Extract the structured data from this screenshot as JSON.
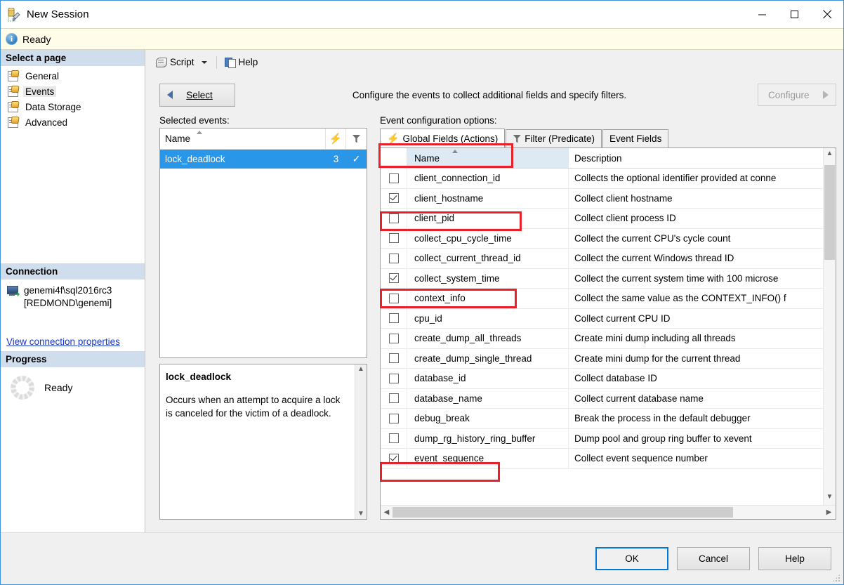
{
  "window": {
    "title": "New Session",
    "icon": "new-session-icon",
    "controls": {
      "minimize": "─",
      "maximize": "☐",
      "close": "✕"
    }
  },
  "status": {
    "icon": "info-icon",
    "text": "Ready"
  },
  "sidebar": {
    "header": "Select a page",
    "items": [
      {
        "label": "General",
        "selected": false
      },
      {
        "label": "Events",
        "selected": true
      },
      {
        "label": "Data Storage",
        "selected": false
      },
      {
        "label": "Advanced",
        "selected": false
      }
    ],
    "connection": {
      "header": "Connection",
      "server": "genemi4f\\sql2016rc3",
      "user": "[REDMOND\\genemi]",
      "link": "View connection properties"
    },
    "progress": {
      "header": "Progress",
      "text": "Ready"
    }
  },
  "toolbar": {
    "script_label": "Script",
    "help_label": "Help"
  },
  "instruction": {
    "select_button": "Select",
    "text": "Configure the events to collect additional fields and specify filters.",
    "configure_button": "Configure"
  },
  "selected_events": {
    "label": "Selected events:",
    "columns": [
      "Name",
      "actions-column",
      "filter-column"
    ],
    "rows": [
      {
        "name": "lock_deadlock",
        "actions": "3",
        "filter": "✓",
        "selected": true
      }
    ]
  },
  "description": {
    "title": "lock_deadlock",
    "text": "Occurs when an attempt to acquire a lock is canceled for the victim of a deadlock."
  },
  "event_config": {
    "label": "Event configuration options:",
    "tabs": [
      {
        "label": "Global Fields (Actions)",
        "icon": "lightning-icon",
        "active": true,
        "highlighted": true
      },
      {
        "label": "Filter (Predicate)",
        "icon": "funnel-icon",
        "active": false,
        "highlighted": false
      },
      {
        "label": "Event Fields",
        "icon": "",
        "active": false,
        "highlighted": false
      }
    ],
    "columns": {
      "name": "Name",
      "description": "Description"
    },
    "rows": [
      {
        "checked": false,
        "name": "client_connection_id",
        "description": "Collects the optional identifier provided at conne",
        "highlighted": false
      },
      {
        "checked": true,
        "name": "client_hostname",
        "description": "Collect client hostname",
        "highlighted": true
      },
      {
        "checked": false,
        "name": "client_pid",
        "description": "Collect client process ID",
        "highlighted": false
      },
      {
        "checked": false,
        "name": "collect_cpu_cycle_time",
        "description": "Collect the current CPU's cycle count",
        "highlighted": false
      },
      {
        "checked": false,
        "name": "collect_current_thread_id",
        "description": "Collect the current Windows thread ID",
        "highlighted": false
      },
      {
        "checked": true,
        "name": "collect_system_time",
        "description": "Collect the current system time with 100 microse",
        "highlighted": true
      },
      {
        "checked": false,
        "name": "context_info",
        "description": "Collect the same value as the CONTEXT_INFO() f",
        "highlighted": false
      },
      {
        "checked": false,
        "name": "cpu_id",
        "description": "Collect current CPU ID",
        "highlighted": false
      },
      {
        "checked": false,
        "name": "create_dump_all_threads",
        "description": "Create mini dump including all threads",
        "highlighted": false
      },
      {
        "checked": false,
        "name": "create_dump_single_thread",
        "description": "Create mini dump for the current thread",
        "highlighted": false
      },
      {
        "checked": false,
        "name": "database_id",
        "description": "Collect database ID",
        "highlighted": false
      },
      {
        "checked": false,
        "name": "database_name",
        "description": "Collect current database name",
        "highlighted": false
      },
      {
        "checked": false,
        "name": "debug_break",
        "description": "Break the process in the default debugger",
        "highlighted": false
      },
      {
        "checked": false,
        "name": "dump_rg_history_ring_buffer",
        "description": "Dump pool and group ring buffer to xevent",
        "highlighted": false
      },
      {
        "checked": true,
        "name": "event_sequence",
        "description": "Collect event sequence number",
        "highlighted": true
      }
    ]
  },
  "footer": {
    "ok": "OK",
    "cancel": "Cancel",
    "help": "Help"
  },
  "colors": {
    "accent": "#0078d7",
    "highlight_red": "#e8212a",
    "selection_blue": "#2a96e8",
    "status_yellow": "#fffce8",
    "section_header": "#cfdded"
  }
}
